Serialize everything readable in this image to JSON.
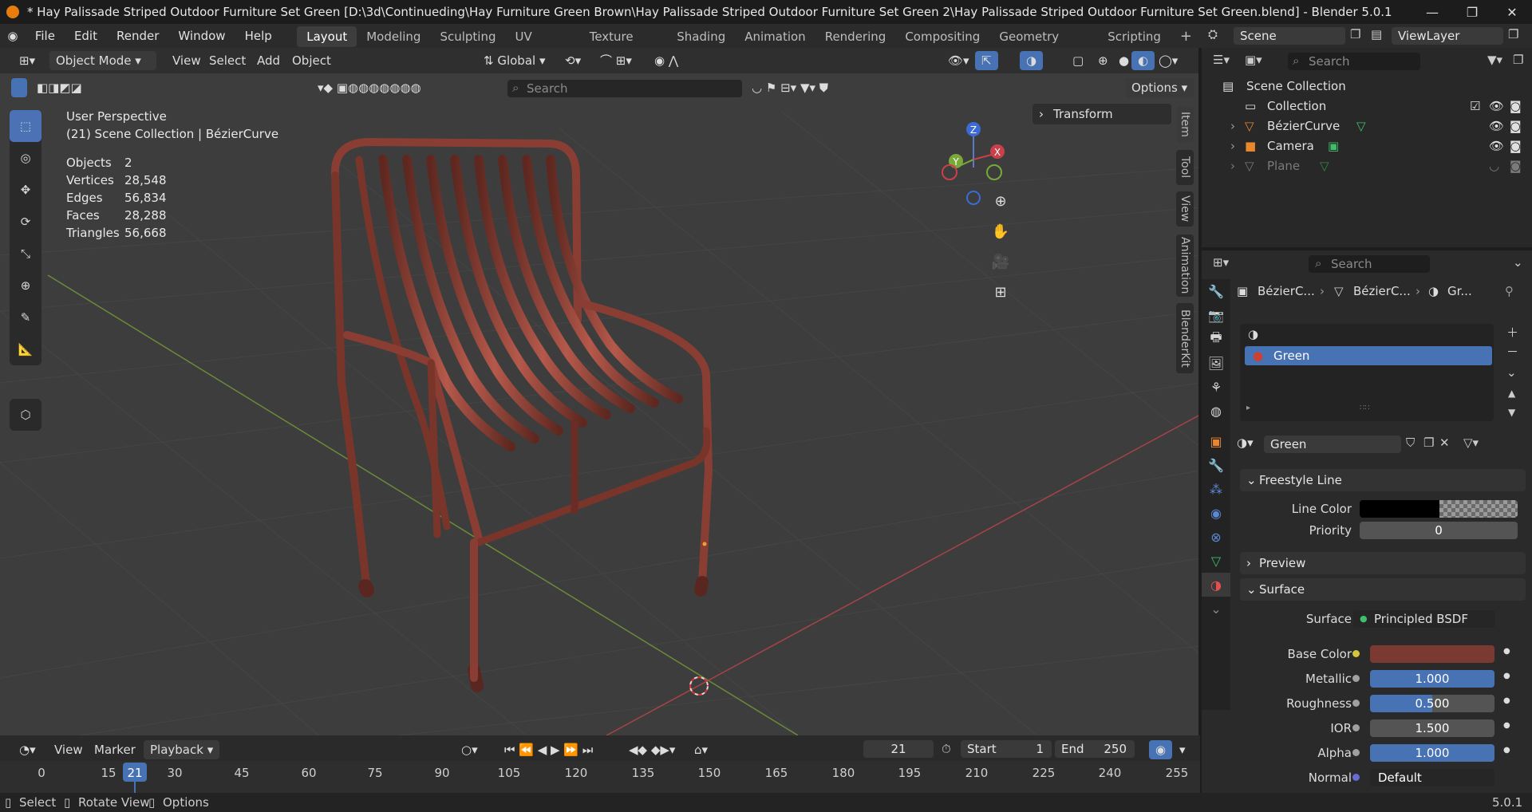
{
  "titlebar": {
    "title": "* Hay Palissade Striped Outdoor Furniture Set Green [D:\\3d\\Continueding\\Hay Furniture Green Brown\\Hay Palissade Striped Outdoor Furniture Set Green 2\\Hay Palissade Striped Outdoor Furniture Set Green.blend] - Blender 5.0.1",
    "minimize": "—",
    "maximize": "❐",
    "close": "✕"
  },
  "menu": {
    "items": [
      "File",
      "Edit",
      "Render",
      "Window",
      "Help"
    ],
    "workspaces": [
      "Layout",
      "Modeling",
      "Sculpting",
      "UV Editing",
      "Texture Paint",
      "Shading",
      "Animation",
      "Rendering",
      "Compositing",
      "Geometry Nodes",
      "Scripting"
    ],
    "add_tab": "+",
    "scene": "Scene",
    "view_layer": "ViewLayer"
  },
  "viewport": {
    "mode": "Object Mode",
    "menus": [
      "View",
      "Select",
      "Add",
      "Object"
    ],
    "orientation": "Global",
    "search_placeholder": "Search",
    "options": "Options",
    "perspective": "User Perspective",
    "collection_info": "(21) Scene Collection | BézierCurve",
    "transform_panel": "Transform",
    "stats": [
      {
        "label": "Objects",
        "value": "2"
      },
      {
        "label": "Vertices",
        "value": "28,548"
      },
      {
        "label": "Edges",
        "value": "56,834"
      },
      {
        "label": "Faces",
        "value": "28,288"
      },
      {
        "label": "Triangles",
        "value": "56,668"
      }
    ],
    "side_tabs": [
      "Item",
      "Tool",
      "View",
      "Animation",
      "BlenderKit"
    ],
    "gizmo": {
      "x": "X",
      "y": "Y",
      "z": "Z"
    }
  },
  "outliner": {
    "search_placeholder": "Search",
    "root": "Scene Collection",
    "collection": "Collection",
    "objects": [
      "BézierCurve",
      "Camera",
      "Plane"
    ]
  },
  "properties": {
    "search_placeholder": "Search",
    "breadcrumb": [
      "BézierC...",
      "BézierC...",
      "Gr..."
    ],
    "material_slot": "Green",
    "material_name": "Green",
    "panels": {
      "freestyle": "Freestyle Line",
      "line_color_label": "Line Color",
      "priority_label": "Priority",
      "priority_value": "0",
      "preview": "Preview",
      "surface": "Surface"
    },
    "surface": {
      "surface_label": "Surface",
      "surface_value": "Principled BSDF",
      "base_color_label": "Base Color",
      "base_color": "#7a3a32",
      "metallic_label": "Metallic",
      "metallic": "1.000",
      "roughness_label": "Roughness",
      "roughness": "0.500",
      "ior_label": "IOR",
      "ior": "1.500",
      "alpha_label": "Alpha",
      "alpha": "1.000",
      "normal_label": "Normal",
      "normal": "Default"
    }
  },
  "timeline": {
    "menus": [
      "View",
      "Marker",
      "Playback"
    ],
    "current_frame": "21",
    "start_label": "Start",
    "start": "1",
    "end_label": "End",
    "end": "250",
    "ticks": [
      "0",
      "15",
      "21",
      "30",
      "45",
      "60",
      "75",
      "90",
      "105",
      "120",
      "135",
      "150",
      "165",
      "180",
      "195",
      "210",
      "225",
      "240",
      "255"
    ]
  },
  "statusbar": {
    "select": "Select",
    "rotate": "Rotate View",
    "options": "Options",
    "version": "5.0.1"
  },
  "colors": {
    "accent": "#4772b3",
    "chair": "#8a3e33",
    "x_axis": "#c9404a",
    "y_axis": "#7aa83a"
  }
}
